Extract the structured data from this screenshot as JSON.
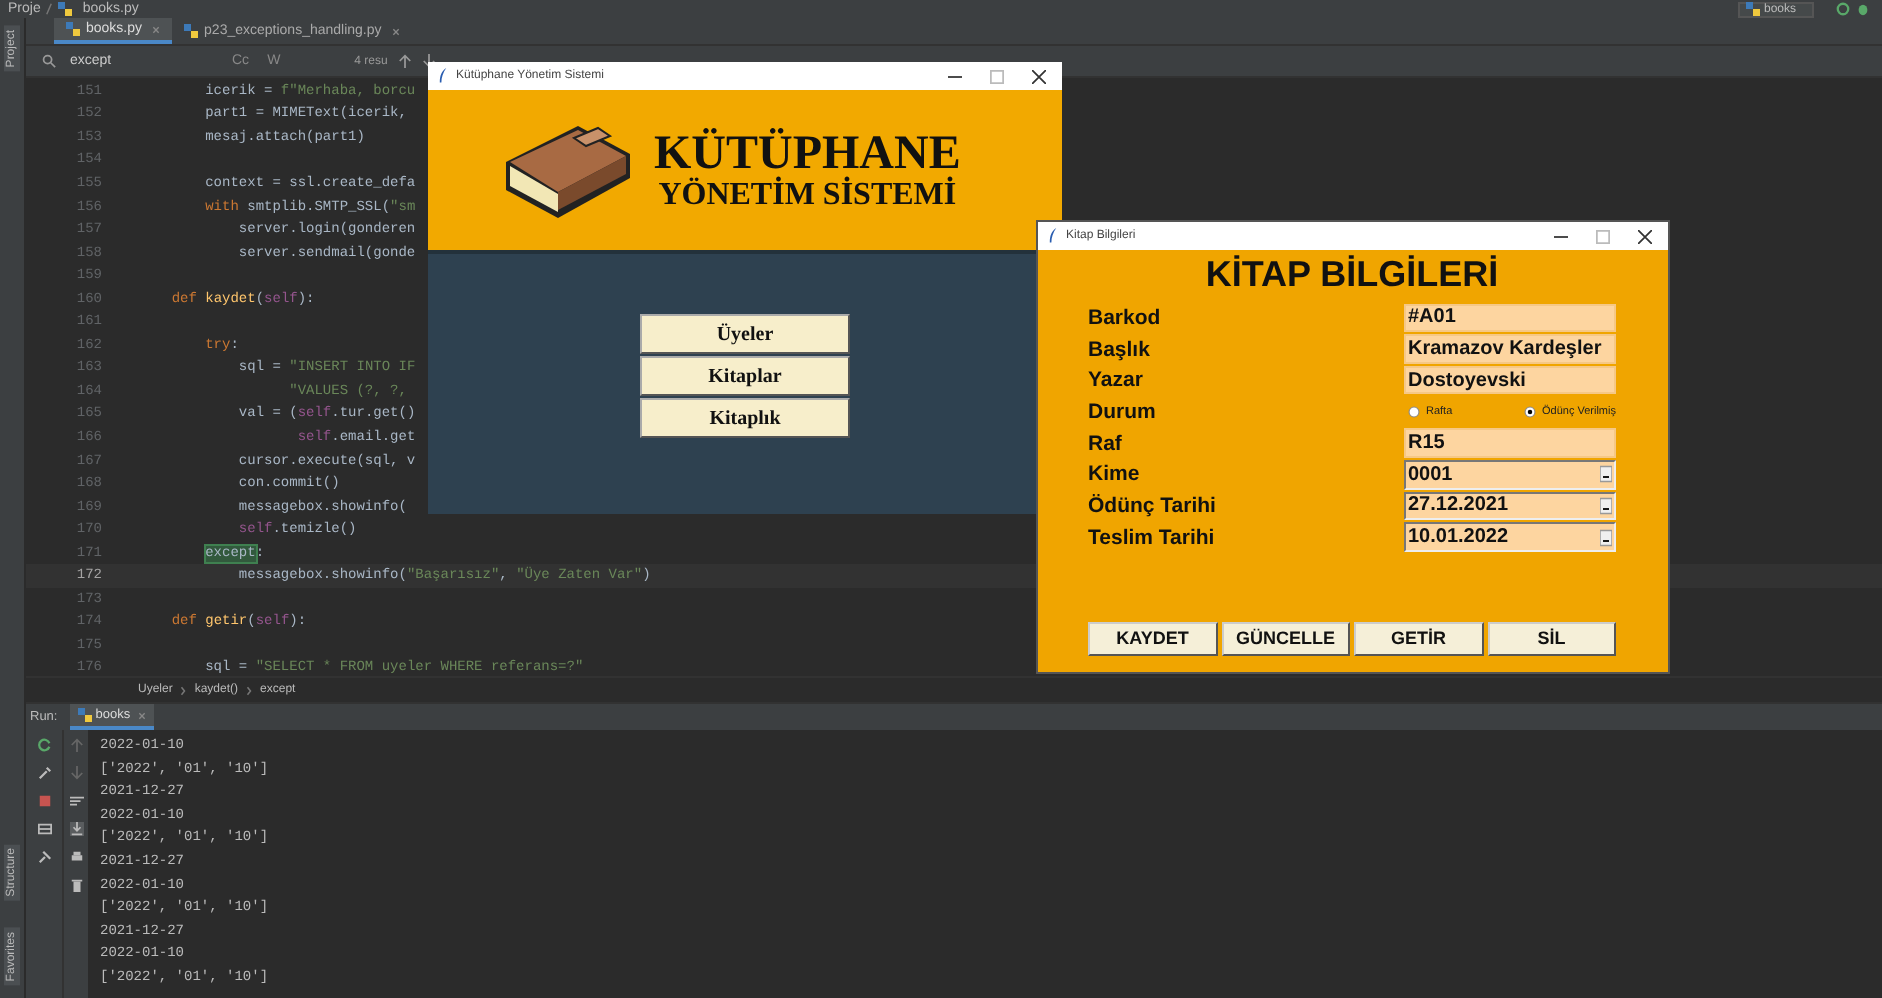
{
  "ide": {
    "path": [
      "Proje",
      "books.py"
    ],
    "run_config": "books",
    "left_tools": [
      "Project"
    ],
    "bottom_tools": [
      "Structure",
      "Favorites"
    ],
    "tabs": [
      {
        "label": "books.py",
        "selected": true
      },
      {
        "label": "p23_exceptions_handling.py",
        "selected": false
      }
    ],
    "search": {
      "value": "except",
      "options": [
        "Cc",
        "W"
      ],
      "results": "4 resu"
    },
    "code_lines": [
      {
        "number": "151",
        "current": false,
        "tokens": [
          {
            "kind": "plain",
            "text": "        icerik = "
          },
          {
            "kind": "string",
            "text": "f\"Merhaba, borcu"
          }
        ]
      },
      {
        "number": "152",
        "current": false,
        "tokens": [
          {
            "kind": "plain",
            "text": "        part1 = MIMEText(icerik,"
          }
        ]
      },
      {
        "number": "153",
        "current": false,
        "tokens": [
          {
            "kind": "plain",
            "text": "        mesaj.attach(part1)"
          }
        ]
      },
      {
        "number": "154",
        "current": false
      },
      {
        "number": "155",
        "current": false,
        "tokens": [
          {
            "kind": "plain",
            "text": "        context = ssl.create_defa"
          }
        ]
      },
      {
        "number": "156",
        "current": false,
        "tokens": [
          {
            "kind": "keyword",
            "text": "        with "
          },
          {
            "kind": "plain",
            "text": "smtplib.SMTP_SSL("
          },
          {
            "kind": "string",
            "text": "\"sm"
          }
        ]
      },
      {
        "number": "157",
        "current": false,
        "tokens": [
          {
            "kind": "plain",
            "text": "            server.login(gonderen"
          }
        ]
      },
      {
        "number": "158",
        "current": false,
        "tokens": [
          {
            "kind": "plain",
            "text": "            server.sendmail(gonde"
          }
        ]
      },
      {
        "number": "159",
        "current": false
      },
      {
        "number": "160",
        "current": false,
        "tokens": [
          {
            "kind": "keyword",
            "text": "    def "
          },
          {
            "kind": "function",
            "text": "kaydet"
          },
          {
            "kind": "plain",
            "text": "("
          },
          {
            "kind": "self",
            "text": "self"
          },
          {
            "kind": "plain",
            "text": "):"
          }
        ]
      },
      {
        "number": "161",
        "current": false
      },
      {
        "number": "162",
        "current": false,
        "tokens": [
          {
            "kind": "keyword",
            "text": "        try"
          },
          {
            "kind": "plain",
            "text": ":"
          }
        ]
      },
      {
        "number": "163",
        "current": false,
        "tokens": [
          {
            "kind": "plain",
            "text": "            sql = "
          },
          {
            "kind": "string",
            "text": "\"INSERT INTO IF"
          }
        ]
      },
      {
        "number": "164",
        "current": false,
        "tokens": [
          {
            "kind": "string",
            "text": "                  \"VALUES (?, ?,"
          }
        ]
      },
      {
        "number": "165",
        "current": false,
        "tokens": [
          {
            "kind": "plain",
            "text": "            val = ("
          },
          {
            "kind": "self",
            "text": "self"
          },
          {
            "kind": "plain",
            "text": ".tur.get()"
          }
        ]
      },
      {
        "number": "166",
        "current": false,
        "tokens": [
          {
            "kind": "self",
            "text": "                   self"
          },
          {
            "kind": "plain",
            "text": ".email.get"
          }
        ]
      },
      {
        "number": "167",
        "current": false,
        "tokens": [
          {
            "kind": "plain",
            "text": "            cursor.execute(sql, v"
          }
        ]
      },
      {
        "number": "168",
        "current": false,
        "tokens": [
          {
            "kind": "plain",
            "text": "            con.commit()"
          }
        ]
      },
      {
        "number": "169",
        "current": false,
        "tokens": [
          {
            "kind": "plain",
            "text": "            messagebox.showinfo("
          }
        ]
      },
      {
        "number": "170",
        "current": false,
        "tokens": [
          {
            "kind": "self",
            "text": "            self"
          },
          {
            "kind": "plain",
            "text": ".temizle()"
          }
        ]
      },
      {
        "number": "171",
        "current": false,
        "tokens": [
          {
            "kind": "match",
            "text": "        except"
          },
          {
            "kind": "plain",
            "text": ":"
          }
        ]
      },
      {
        "number": "172",
        "current": true,
        "tokens": [
          {
            "kind": "plain",
            "text": "            messagebox.showinfo("
          },
          {
            "kind": "string",
            "text": "\"Başarısız\""
          },
          {
            "kind": "plain",
            "text": ", "
          },
          {
            "kind": "string",
            "text": "\"Üye Zaten Var\""
          },
          {
            "kind": "plain",
            "text": ")"
          }
        ]
      },
      {
        "number": "173",
        "current": false
      },
      {
        "number": "174",
        "current": false,
        "tokens": [
          {
            "kind": "keyword",
            "text": "    def "
          },
          {
            "kind": "function",
            "text": "getir"
          },
          {
            "kind": "plain",
            "text": "("
          },
          {
            "kind": "self",
            "text": "self"
          },
          {
            "kind": "plain",
            "text": "):"
          }
        ]
      },
      {
        "number": "175",
        "current": false
      },
      {
        "number": "176",
        "current": false,
        "tokens": [
          {
            "kind": "plain",
            "text": "        sql = "
          },
          {
            "kind": "string",
            "text": "\"SELECT * FROM uyeler WHERE referans=?\""
          }
        ]
      }
    ],
    "code_path": [
      "Uyeler",
      "kaydet()",
      "except"
    ],
    "run": {
      "label": "Run:",
      "tab": "books",
      "output": [
        "2022-01-10",
        "['2022', '01', '10']",
        "2021-12-27",
        "2022-01-10",
        "['2022', '01', '10']",
        "2021-12-27",
        "2022-01-10",
        "['2022', '01', '10']",
        "2021-12-27",
        "2022-01-10",
        "['2022', '01', '10']"
      ]
    }
  },
  "main_window": {
    "title": "Kütüphane Yönetim Sistemi",
    "heading": "KÜTÜPHANE",
    "subheading": "YÖNETİM SİSTEMİ",
    "buttons": [
      "Üyeler",
      "Kitaplar",
      "Kitaplık"
    ]
  },
  "book_window": {
    "title": "Kitap Bilgileri",
    "heading": "KİTAP BİLGİLERİ",
    "fields": [
      {
        "label": "Barkod",
        "kind": "entry",
        "value": "#A01"
      },
      {
        "label": "Başlık",
        "kind": "entry",
        "value": "Kramazov Kardeşler"
      },
      {
        "label": "Yazar",
        "kind": "entry",
        "value": "Dostoyevski"
      },
      {
        "label": "Durum",
        "kind": "radio",
        "options": [
          {
            "label": "Rafta",
            "selected": false
          },
          {
            "label": "Ödünç Verilmiş",
            "selected": true
          }
        ]
      },
      {
        "label": "Raf",
        "kind": "entry",
        "value": "R15"
      },
      {
        "label": "Kime",
        "kind": "combo",
        "value": "0001"
      },
      {
        "label": "Ödünç Tarihi",
        "kind": "combo",
        "value": "27.12.2021"
      },
      {
        "label": "Teslim Tarihi",
        "kind": "combo",
        "value": "10.01.2022"
      }
    ],
    "buttons": [
      "KAYDET",
      "GÜNCELLE",
      "GETİR",
      "SİL"
    ]
  }
}
